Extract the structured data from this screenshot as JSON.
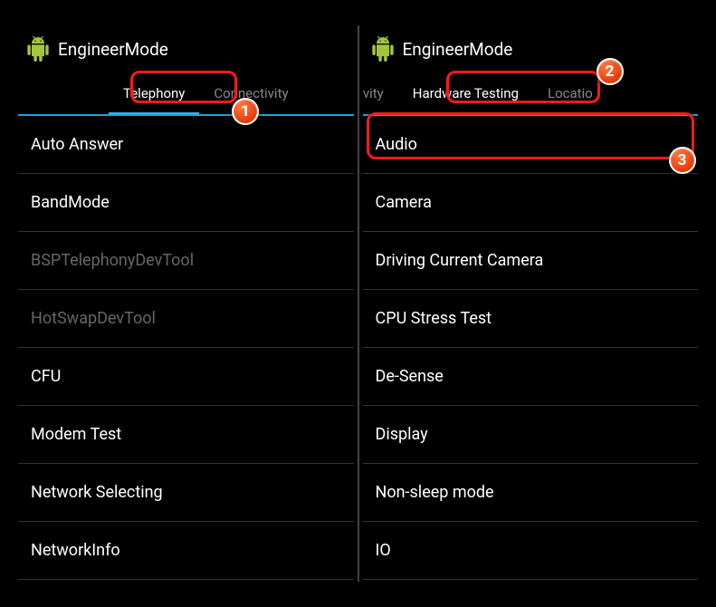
{
  "app_title": "EngineerMode",
  "colors": {
    "accent": "#33b5e5",
    "highlight": "#ff1a1a",
    "badge_bg": "#e63a0c"
  },
  "badges": {
    "b1": "1",
    "b2": "2",
    "b3": "3"
  },
  "left_screen": {
    "tabs": [
      {
        "label": "Telephony",
        "active": true
      },
      {
        "label": "Connectivity",
        "active": false
      }
    ],
    "items": [
      {
        "label": "Auto Answer",
        "disabled": false
      },
      {
        "label": "BandMode",
        "disabled": false
      },
      {
        "label": "BSPTelephonyDevTool",
        "disabled": true
      },
      {
        "label": "HotSwapDevTool",
        "disabled": true
      },
      {
        "label": "CFU",
        "disabled": false
      },
      {
        "label": "Modem Test",
        "disabled": false
      },
      {
        "label": "Network Selecting",
        "disabled": false
      },
      {
        "label": "NetworkInfo",
        "disabled": false
      }
    ]
  },
  "right_screen": {
    "tabs": [
      {
        "label": "ectivity",
        "active": false
      },
      {
        "label": "Hardware Testing",
        "active": true
      },
      {
        "label": "Locatio",
        "active": false
      }
    ],
    "items": [
      {
        "label": "Audio",
        "disabled": false
      },
      {
        "label": "Camera",
        "disabled": false
      },
      {
        "label": "Driving Current Camera",
        "disabled": false
      },
      {
        "label": "CPU Stress Test",
        "disabled": false
      },
      {
        "label": "De-Sense",
        "disabled": false
      },
      {
        "label": "Display",
        "disabled": false
      },
      {
        "label": "Non-sleep mode",
        "disabled": false
      },
      {
        "label": "IO",
        "disabled": false
      }
    ]
  }
}
